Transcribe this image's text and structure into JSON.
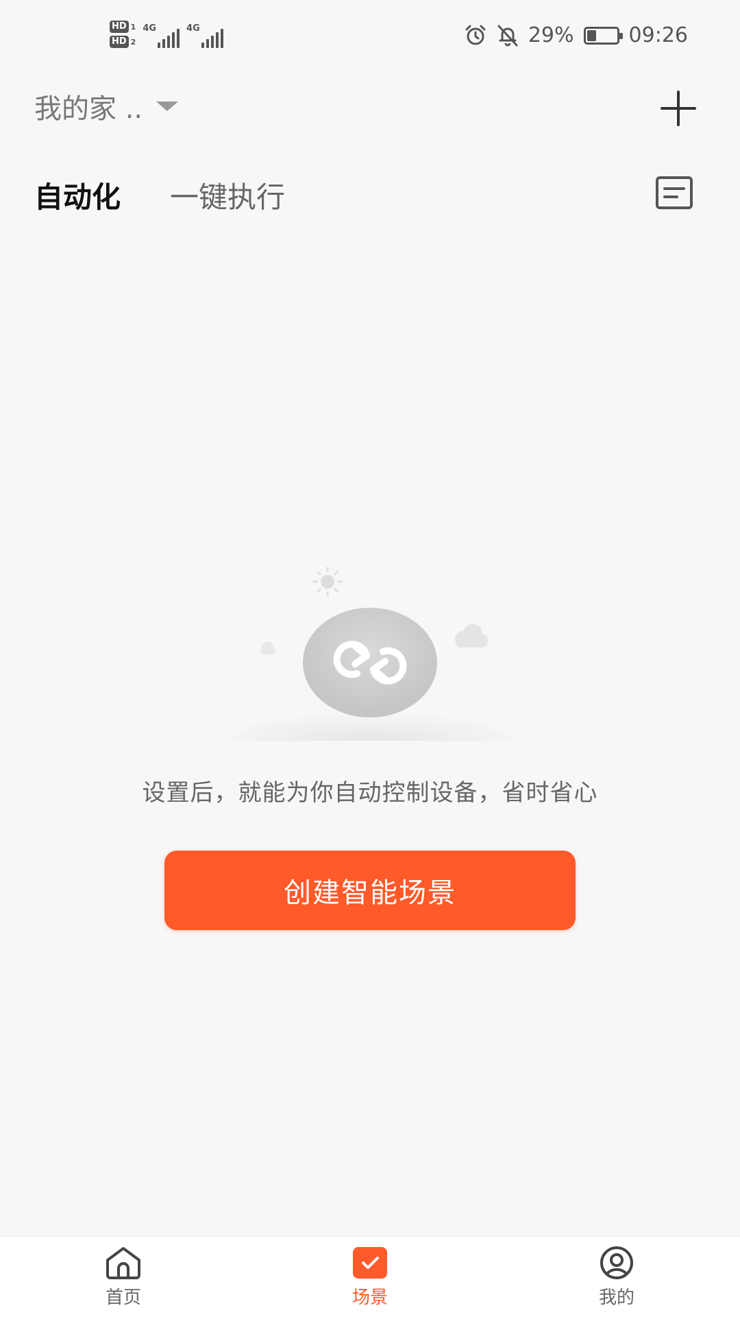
{
  "status_bar": {
    "hd1": "HD",
    "hd1_num": "1",
    "hd2": "HD",
    "hd2_num": "2",
    "net1": "4G",
    "net2": "4G",
    "battery_percent": "29%",
    "battery_level": 0.29,
    "time": "09:26",
    "icons": [
      "alarm-icon",
      "mute-icon",
      "battery-icon"
    ]
  },
  "header": {
    "home_name": "我的家 ..",
    "add_icon": "plus-icon"
  },
  "tabs": [
    {
      "label": "自动化",
      "active": true
    },
    {
      "label": "一键执行",
      "active": false
    }
  ],
  "empty_state": {
    "message": "设置后，就能为你自动控制设备，省时省心",
    "button_label": "创建智能场景",
    "accent": "#ff5a2a"
  },
  "bottom_nav": [
    {
      "label": "首页",
      "icon": "home-icon",
      "active": false
    },
    {
      "label": "场景",
      "icon": "scene-check-icon",
      "active": true
    },
    {
      "label": "我的",
      "icon": "user-profile-icon",
      "active": false
    }
  ]
}
